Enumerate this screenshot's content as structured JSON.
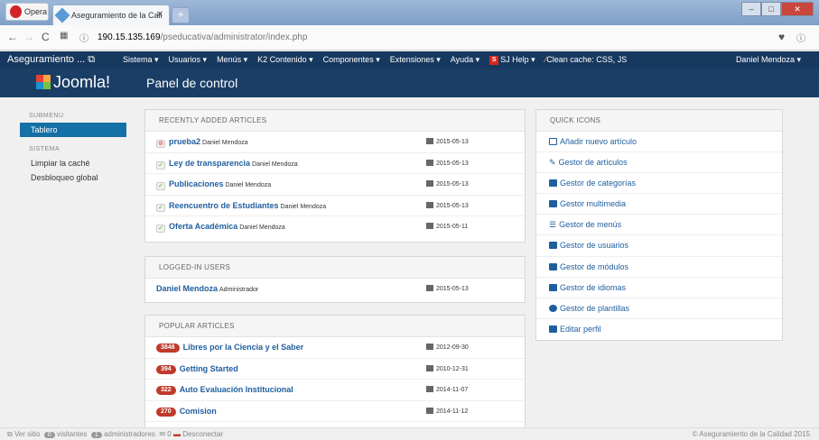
{
  "browser": {
    "opera_label": "Opera",
    "tab_title": "Aseguramiento de la Cali",
    "url_host": "190.15.135.169",
    "url_path": "/pseducativa/administrator/index.php"
  },
  "topnav": {
    "brand": "Aseguramiento ... ",
    "menu": [
      "Sistema ▾",
      "Usuarios ▾",
      "Menús ▾",
      "K2 Contenido ▾",
      "Componentes ▾",
      "Extensiones ▾",
      "Ayuda ▾"
    ],
    "sj_help": "SJ Help ▾",
    "clean_cache": "Clean cache: CSS, JS",
    "user": "Daniel Mendoza ▾"
  },
  "header": {
    "logo": "Joomla!",
    "title": "Panel de control"
  },
  "sidebar": {
    "submenu_heading": "SUBMENÚ",
    "active_item": "Tablero",
    "system_heading": "SISTEMA",
    "items": [
      "Limpiar la caché",
      "Desbloqueo global"
    ]
  },
  "recent": {
    "heading": "RECENTLY ADDED ARTICLES",
    "rows": [
      {
        "title": "prueba2",
        "author": "Daniel Mendoza",
        "date": "2015-05-13",
        "status": "unpublished"
      },
      {
        "title": "Ley de transparencia",
        "author": "Daniel Mendoza",
        "date": "2015-05-13",
        "status": "published"
      },
      {
        "title": "Publicaciones",
        "author": "Daniel Mendoza",
        "date": "2015-05-13",
        "status": "published"
      },
      {
        "title": "Reencuentro de Estudiantes",
        "author": "Daniel Mendoza",
        "date": "2015-05-13",
        "status": "published"
      },
      {
        "title": "Oferta Académica",
        "author": "Daniel Mendoza",
        "date": "2015-05-11",
        "status": "published"
      }
    ]
  },
  "logged": {
    "heading": "LOGGED-IN USERS",
    "rows": [
      {
        "name": "Daniel Mendoza",
        "role": "Administrador",
        "date": "2015-05-13"
      }
    ]
  },
  "popular": {
    "heading": "POPULAR ARTICLES",
    "rows": [
      {
        "hits": "3848",
        "title": "Libres por la Ciencia y el Saber",
        "date": "2012-09-30"
      },
      {
        "hits": "394",
        "title": "Getting Started",
        "date": "2010-12-31"
      },
      {
        "hits": "322",
        "title": "Auto Evaluación Institucional",
        "date": "2014-11-07"
      },
      {
        "hits": "270",
        "title": "Comision",
        "date": "2014-11-12"
      }
    ]
  },
  "quickicons": {
    "heading": "QUICK ICONS",
    "items": [
      {
        "label": "Añadir nuevo artículo",
        "icon": "new-article-icon"
      },
      {
        "label": "Gestor de artículos",
        "icon": "pencil-icon"
      },
      {
        "label": "Gestor de categorías",
        "icon": "folder-icon"
      },
      {
        "label": "Gestor multimedia",
        "icon": "image-icon"
      },
      {
        "label": "Gestor de menús",
        "icon": "list-icon"
      },
      {
        "label": "Gestor de usuarios",
        "icon": "user-icon"
      },
      {
        "label": "Gestor de módulos",
        "icon": "cube-icon"
      },
      {
        "label": "Gestor de idiomas",
        "icon": "comment-icon"
      },
      {
        "label": "Gestor de plantillas",
        "icon": "eye-icon"
      },
      {
        "label": "Editar perfil",
        "icon": "profile-icon"
      }
    ]
  },
  "footer": {
    "view_site": "Ver sitio",
    "visitors_count": "0",
    "visitors": "visitantes",
    "admins_count": "1",
    "admins": "administradores",
    "messages": "0",
    "logout": "Desconectar",
    "copyright": "© Aseguramiento de la Calidad 2015"
  }
}
